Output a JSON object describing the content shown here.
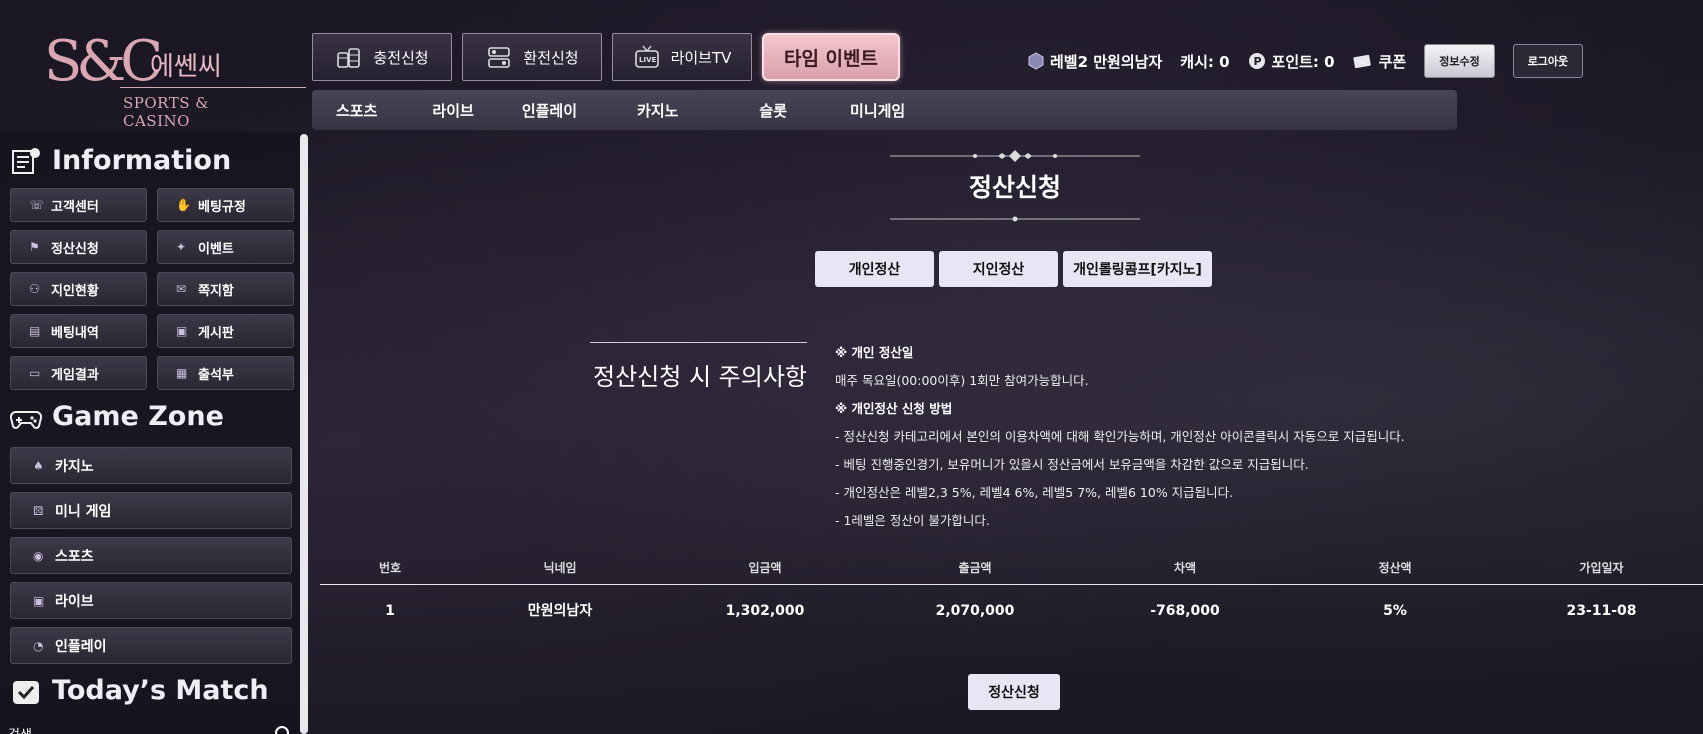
{
  "logo": {
    "monogram": "S&C",
    "korean": "에쎈씨",
    "english": "SPORTS & CASINO"
  },
  "top_buttons": [
    {
      "label": "충전신청",
      "icon": "coins-icon"
    },
    {
      "label": "환전신청",
      "icon": "exchange-icon"
    },
    {
      "label": "라이브TV",
      "icon": "live-tv-icon"
    },
    {
      "label": "타임 이벤트",
      "icon": ""
    }
  ],
  "user": {
    "level_name": "레벨2 만원의남자",
    "cash": "캐시: 0",
    "points": "포인트: 0",
    "coupon": "쿠폰",
    "edit_label": "정보수정",
    "logout_label": "로그아웃"
  },
  "nav": [
    "스포츠",
    "라이브",
    "인플레이",
    "카지노",
    "슬롯",
    "미니게임"
  ],
  "sidebar": {
    "info_title": "Information",
    "info_items": [
      {
        "label": "고객센터",
        "icon": "phone-icon"
      },
      {
        "label": "베팅규정",
        "icon": "hand-icon"
      },
      {
        "label": "정산신청",
        "icon": "settle-icon"
      },
      {
        "label": "이벤트",
        "icon": "party-icon"
      },
      {
        "label": "지인현황",
        "icon": "people-icon"
      },
      {
        "label": "쪽지함",
        "icon": "message-icon"
      },
      {
        "label": "베팅내역",
        "icon": "list-icon"
      },
      {
        "label": "게시판",
        "icon": "board-icon"
      },
      {
        "label": "게임결과",
        "icon": "monitor-icon"
      },
      {
        "label": "출석부",
        "icon": "calendar-icon"
      }
    ],
    "game_title": "Game Zone",
    "game_items": [
      {
        "label": "카지노",
        "icon": "spade-icon"
      },
      {
        "label": "미니 게임",
        "icon": "dice-icon"
      },
      {
        "label": "스포츠",
        "icon": "ball-icon"
      },
      {
        "label": "라이브",
        "icon": "live-icon"
      },
      {
        "label": "인플레이",
        "icon": "timer-icon"
      }
    ],
    "match_title": "Today’s Match",
    "search_label": "검색"
  },
  "main": {
    "title": "정산신청",
    "tabs": [
      "개인정산",
      "지인정산",
      "개인롤링콤프[카지노]"
    ],
    "notice_heading": "정산신청 시 주의사항",
    "notice_lines": [
      {
        "text": "※ 개인 정산일",
        "bold": true
      },
      {
        "text": "매주 목요일(00:00이후) 1회만 참여가능합니다.",
        "bold": false
      },
      {
        "text": "※ 개인정산 신청 방법",
        "bold": true
      },
      {
        "text": "- 정산신청 카테고리에서 본인의 이용차액에 대해 확인가능하며, 개인정산 아이콘클릭시 자동으로 지급됩니다.",
        "bold": false
      },
      {
        "text": "- 베팅 진행중인경기, 보유머니가 있을시 정산금에서 보유금액을 차감한 값으로 지급됩니다.",
        "bold": false
      },
      {
        "text": "- 개인정산은 레벨2,3 5%, 레벨4 6%, 레벨5 7%, 레벨6 10% 지급됩니다.",
        "bold": false
      },
      {
        "text": "- 1레벨은 정산이 불가합니다.",
        "bold": false
      }
    ],
    "table": {
      "headers": [
        "번호",
        "닉네임",
        "입금액",
        "출금액",
        "차액",
        "정산액",
        "가입일자"
      ],
      "rows": [
        [
          "1",
          "만원의남자",
          "1,302,000",
          "2,070,000",
          "-768,000",
          "5%",
          "23-11-08"
        ]
      ]
    },
    "submit_label": "정산신청"
  }
}
